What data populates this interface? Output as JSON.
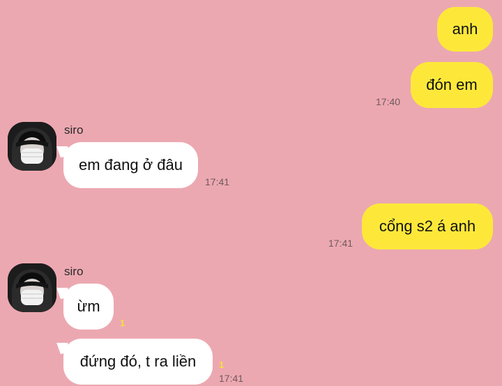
{
  "messages": [
    {
      "id": "m1",
      "direction": "outgoing",
      "text": "anh",
      "time": ""
    },
    {
      "id": "m2",
      "direction": "outgoing",
      "text": "đón em",
      "time": "17:40"
    },
    {
      "id": "m3",
      "direction": "incoming",
      "sender": "siro",
      "text": "em đang ở đâu",
      "time": "17:41"
    },
    {
      "id": "m4",
      "direction": "outgoing",
      "text": "cổng s2 á anh",
      "time": "17:41"
    },
    {
      "id": "m5",
      "direction": "incoming",
      "sender": "siro",
      "text": "ừm",
      "unread": "1",
      "time": ""
    },
    {
      "id": "m6",
      "direction": "incoming",
      "text": "đứng đó, t ra liền",
      "unread": "1",
      "time": "17:41"
    }
  ],
  "colors": {
    "background": "#eca8b1",
    "outgoing_bubble": "#fde83a",
    "incoming_bubble": "#ffffff",
    "unread_count": "#f6e03a"
  },
  "icons": {
    "avatar": "avatar-photo-masked-person"
  }
}
